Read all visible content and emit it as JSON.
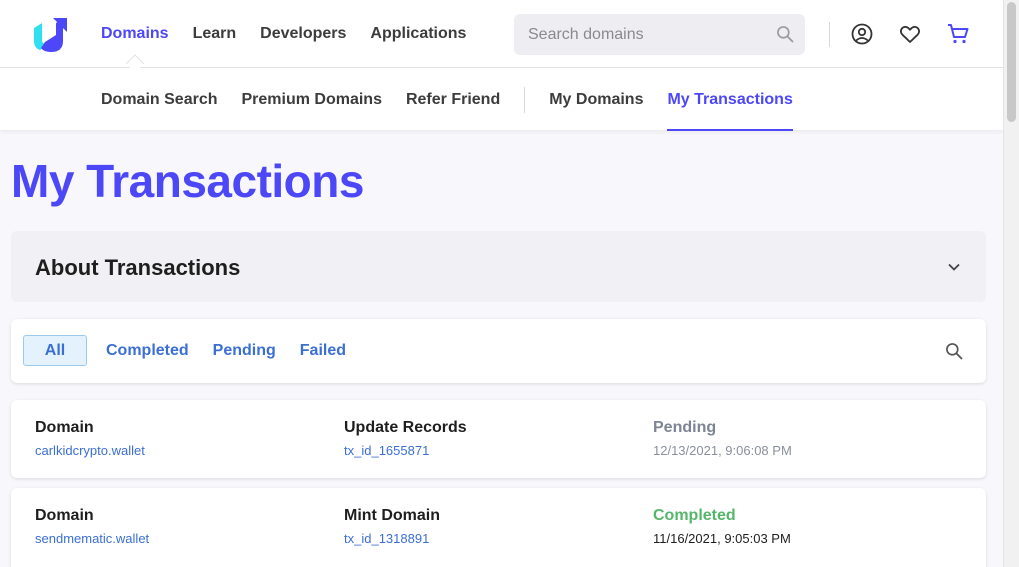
{
  "colors": {
    "accent": "#4c47f7",
    "link": "#3b6fd4",
    "pending": "#7d8494",
    "completed": "#55b66a"
  },
  "header": {
    "nav": [
      {
        "label": "Domains",
        "active": true
      },
      {
        "label": "Learn"
      },
      {
        "label": "Developers"
      },
      {
        "label": "Applications"
      }
    ],
    "search_placeholder": "Search domains",
    "icons": [
      "search-icon",
      "account-icon",
      "heart-icon",
      "cart-icon"
    ]
  },
  "subnav": {
    "items": [
      "Domain Search",
      "Premium Domains",
      "Refer Friend"
    ],
    "items2": [
      "My Domains",
      "My Transactions"
    ]
  },
  "page_title": "My Transactions",
  "about": {
    "title": "About Transactions"
  },
  "filters": {
    "tabs": [
      "All",
      "Completed",
      "Pending",
      "Failed"
    ]
  },
  "transactions": [
    {
      "label": "Domain",
      "domain": "carlkidcrypto.wallet",
      "type": "Update Records",
      "tx_id": "tx_id_1655871",
      "status": "Pending",
      "time": "12/13/2021, 9:06:08 PM"
    },
    {
      "label": "Domain",
      "domain": "sendmematic.wallet",
      "type": "Mint Domain",
      "tx_id": "tx_id_1318891",
      "status": "Completed",
      "time": "11/16/2021, 9:05:03 PM"
    }
  ]
}
